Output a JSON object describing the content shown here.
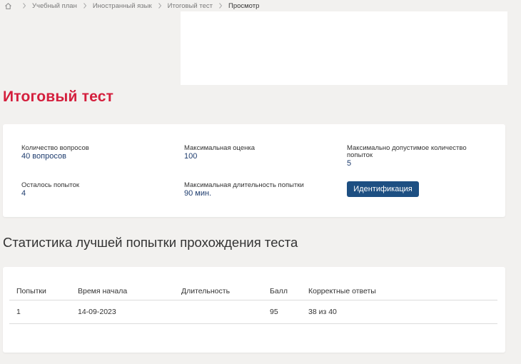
{
  "breadcrumb": {
    "items": [
      "Учебный план",
      "Иностранный язык",
      "Итоговый тест"
    ],
    "current": "Просмотр"
  },
  "page": {
    "title": "Итоговый тест"
  },
  "info": {
    "questions_count": {
      "label": "Количество вопросов",
      "value": "40 вопросов"
    },
    "max_score": {
      "label": "Максимальная оценка",
      "value": "100"
    },
    "max_attempts": {
      "label": "Максимально допустимое количество попыток",
      "value": "5"
    },
    "attempts_left": {
      "label": "Осталось попыток",
      "value": "4"
    },
    "max_duration": {
      "label": "Максимальная длительность попытки",
      "value": "90 мин."
    },
    "identification_button": "Идентификация"
  },
  "stats": {
    "heading": "Статистика лучшей попытки прохождения теста",
    "columns": [
      "Попытки",
      "Время начала",
      "Длительность",
      "Балл",
      "Корректные ответы"
    ],
    "rows": [
      [
        "1",
        "14-09-2023",
        "",
        "95",
        "38 из 40"
      ]
    ]
  },
  "colors": {
    "title": "#d41f3d",
    "accent": "#1d4f82",
    "value": "#1e3c6e"
  }
}
